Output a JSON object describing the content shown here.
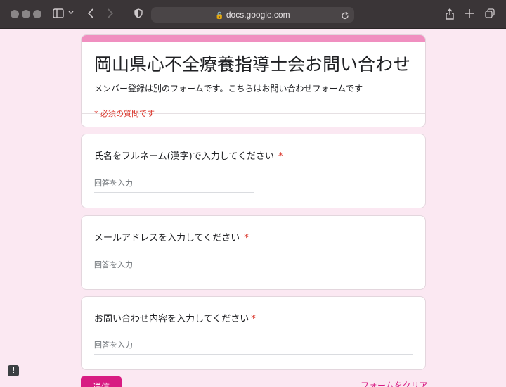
{
  "browser": {
    "url": "docs.google.com"
  },
  "form": {
    "title": "岡山県心不全療養指導士会お問い合わせ",
    "description": "メンバー登録は別のフォームです。こちらはお問い合わせフォームです",
    "required_note": "* 必須の質問です",
    "questions": [
      {
        "label": "氏名をフルネーム(漢字)で入力してください",
        "placeholder": "回答を入力"
      },
      {
        "label": "メールアドレスを入力してください",
        "placeholder": "回答を入力"
      },
      {
        "label": "お問い合わせ内容を入力してください",
        "placeholder": "回答を入力"
      }
    ],
    "required_mark": "*",
    "submit_label": "送信",
    "clear_label": "フォームをクリア"
  },
  "colors": {
    "accent": "#d81b82",
    "header_accent": "#f08fc0",
    "background": "#fbe8f2"
  }
}
